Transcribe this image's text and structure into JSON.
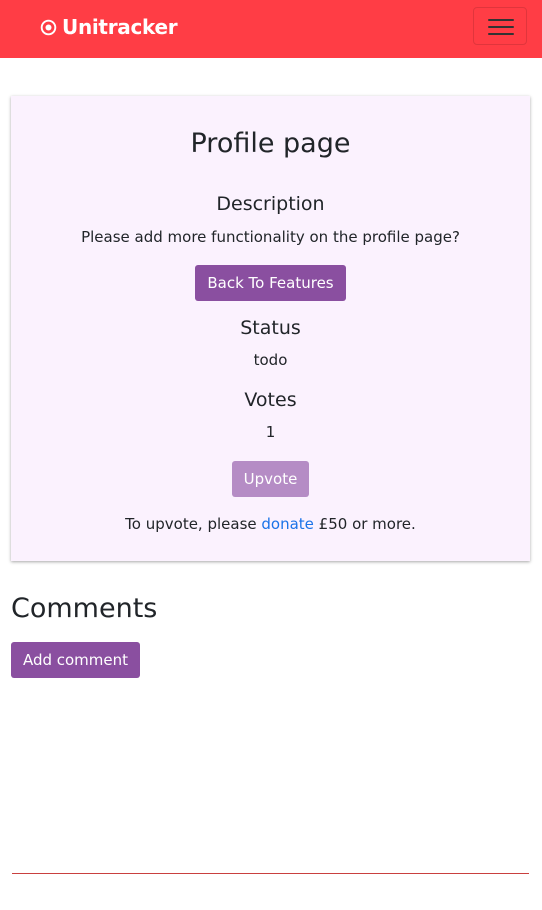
{
  "navbar": {
    "brand": "Unitracker",
    "brand_icon": "target-circle-icon",
    "toggler_icon": "hamburger-menu-icon",
    "background": "#ff3d45"
  },
  "feature": {
    "title": "Profile page",
    "description_heading": "Description",
    "description": "Please add more functionality on the profile page?",
    "back_button": "Back To Features",
    "status_heading": "Status",
    "status": "todo",
    "votes_heading": "Votes",
    "votes": "1",
    "upvote_button": "Upvote",
    "upvote_note_before": "To upvote, please ",
    "upvote_note_link": "donate",
    "upvote_note_after": " £50 or more.",
    "card_background": "#fbf2fe"
  },
  "comments": {
    "heading": "Comments",
    "add_button": "Add comment"
  },
  "colors": {
    "accent": "#8a4fa0",
    "accent_disabled": "#b58cc5",
    "link": "#1a73e8",
    "footer_line": "#c9403f"
  }
}
